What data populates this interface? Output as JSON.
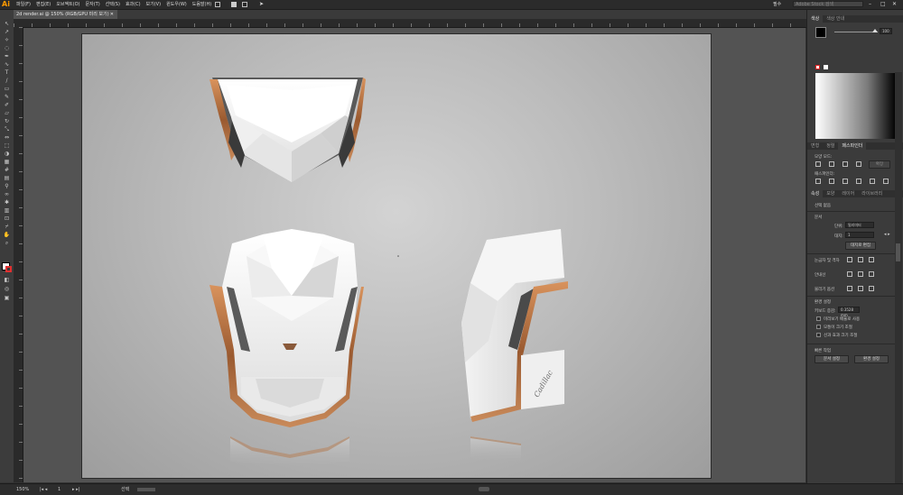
{
  "app": {
    "logo": "Ai"
  },
  "menubar": {
    "items": [
      "파일(F)",
      "편집(E)",
      "오브젝트(O)",
      "문자(T)",
      "선택(S)",
      "효과(C)",
      "보기(V)",
      "윈도우(W)",
      "도움말(H)"
    ],
    "workspace_label": "필수",
    "stock_placeholder": "Adobe Stock 검색",
    "window_controls": [
      "–",
      "□",
      "✕"
    ]
  },
  "tab": {
    "title": "2d render.ai @ 150% (RGB/GPU 미리 보기)",
    "close": "✕"
  },
  "status": {
    "zoom": "150%",
    "page": "1",
    "tool": "선택"
  },
  "panel": {
    "color_tabs": [
      "색상",
      "색상 안내"
    ],
    "color_value": "100",
    "align_tabs": [
      "변형",
      "정렬",
      "패스파인더"
    ],
    "shape_mode_label": "모양 모드:",
    "expand_button": "확장",
    "pathfinder_label": "패스파인더:",
    "props_tabs": [
      "속성",
      "모양",
      "레이어",
      "라이브러리"
    ],
    "no_selection": "선택 없음",
    "document_header": "문서",
    "unit_label": "단위:",
    "unit_value": "밀리미터",
    "artboard_label": "대지:",
    "artboard_value": "1",
    "edit_artboard_button": "대지로 편집",
    "ruler_grid_label": "눈금자 및 격자",
    "guides_label": "안내선",
    "snap_label": "물리기 옵션",
    "prefs_header": "환경 설정",
    "keyboard_increment_label": "키보드 증감:",
    "keyboard_increment_value": "0.3528 mm",
    "check_items": [
      "미리보기 배율로 사용",
      "모퉁이 크기 조절",
      "선과 효과 크기 조절"
    ],
    "quick_actions_header": "빠른 작업",
    "doc_setup_button": "문서 설정",
    "preferences_button": "환경 설정"
  },
  "artwork": {
    "emblem_text": "Cadillac"
  },
  "colors": {
    "accent_copper": "#b8703f",
    "app_bg": "#323232",
    "panel_bg": "#3b3b3b"
  }
}
